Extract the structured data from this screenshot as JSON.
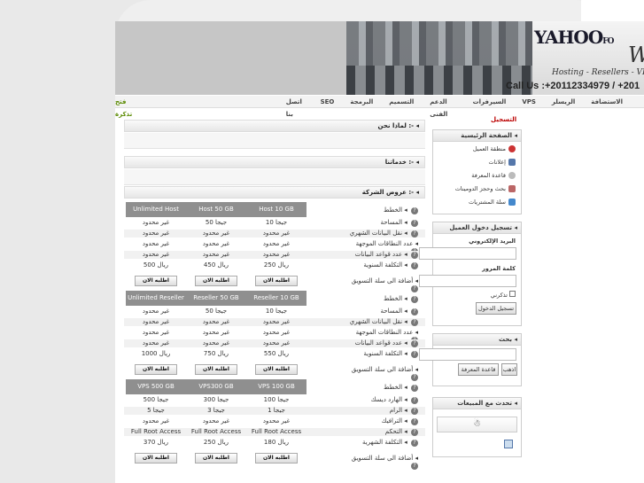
{
  "header": {
    "logo": "YAHOO",
    "logo_suffix": "FO",
    "logo_w": "W",
    "tagline": "Hosting - Resellers - VPS",
    "phone": "Call Us :+20112334979 / +201"
  },
  "nav": [
    "الاستضافة",
    "الريسلر",
    "VPS",
    "السيرفرات",
    "الدعم الفنى",
    "التسميم",
    "البرمجة",
    "SEO",
    "اتصل بنا",
    "فتح تذكرة"
  ],
  "sections": {
    "why_us": "لماذا نحن :-",
    "our_services": "خدماتنا :-",
    "offers": "عروض الشركة :-"
  },
  "plans": [
    {
      "headers": [
        "الخطط",
        "Host 10 GB",
        "Host 50 GB",
        "Unlimited Host"
      ],
      "rows": [
        [
          "المساحة",
          "10 جيجا",
          "50 جيجا",
          "غير محدود"
        ],
        [
          "نقل البيانات الشهري",
          "غير محدود",
          "غير محدود",
          "غير محدود"
        ],
        [
          "عدد النطاقات الموجهة",
          "غير محدود",
          "غير محدود",
          "غير محدود"
        ],
        [
          "عدد قواعد البيانات",
          "غير محدود",
          "غير محدود",
          "غير محدود"
        ],
        [
          "التكلفة السنوية",
          "250 ريال",
          "450 ريال",
          "500 ريال"
        ]
      ],
      "cart_label": "أضافة الى سلة التسويق",
      "order": "اطلبه الان"
    },
    {
      "headers": [
        "الخطط",
        "Reseller 10 GB",
        "Reseller 50 GB",
        "Unlimited Reseller"
      ],
      "rows": [
        [
          "المساحة",
          "10 جيجا",
          "50 جيجا",
          "غير محدود"
        ],
        [
          "نقل البيانات الشهري",
          "غير محدود",
          "غير محدود",
          "غير محدود"
        ],
        [
          "عدد النطاقات الموجهة",
          "غير محدود",
          "غير محدود",
          "غير محدود"
        ],
        [
          "عدد قواعد البيانات",
          "غير محدود",
          "غير محدود",
          "غير محدود"
        ],
        [
          "التكلفة السنوية",
          "550 ريال",
          "750 ريال",
          "1000 ريال"
        ]
      ],
      "cart_label": "أضافة الى سلة التسويق",
      "order": "اطلبه الان"
    },
    {
      "headers": [
        "الخطط",
        "VPS 100 GB",
        "VPS300 GB",
        "VPS 500 GB"
      ],
      "rows": [
        [
          "الهارد ديسك",
          "100 جيجا",
          "300 جيجا",
          "500 جيجا"
        ],
        [
          "الرام",
          "1 جيجا",
          "3 جيجا",
          "5 جيجا"
        ],
        [
          "الترافيك",
          "غير محدود",
          "غير محدود",
          "غير محدود"
        ],
        [
          "التحكم",
          "Full Root Access",
          "Full Root Access",
          "Full Root Access"
        ],
        [
          "التكلفة الشهرية",
          "180 ريال",
          "250 ريال",
          "370 ريال"
        ]
      ],
      "cart_label": "أضافة الى سلة التسويق",
      "order": "اطلبه الان"
    }
  ],
  "sidebar": {
    "register": "التسجيل",
    "main_title": "الصفحة الرئيسية",
    "links": [
      "منطقة العميل",
      "إعلانات",
      "قاعدة المعرفة",
      "بحث وحجز الدومينات",
      "سلة المشتريات"
    ],
    "login_title": "تسجيل دخول العميل",
    "email_label": "البريد الإلكتروني",
    "password_label": "كلمة المرور",
    "remember": "تذكرني",
    "login_button": "تسجيل الدخول",
    "search_title": "بحث",
    "kb_button": "قاعدة المعرفة",
    "go_button": "اذهب",
    "chat_title": "تحدث مع المبيعات"
  }
}
